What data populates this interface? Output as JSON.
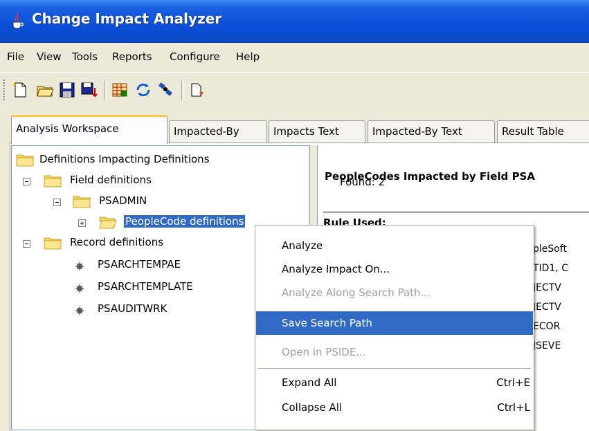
{
  "window": {
    "title": "Change Impact Analyzer",
    "icon": "java-cup-icon"
  },
  "menu": {
    "items": [
      "File",
      "View",
      "Tools",
      "Reports",
      "Configure",
      "Help"
    ]
  },
  "toolbar": {
    "buttons": [
      "new-document-icon",
      "open-folder-icon",
      "save-icon",
      "save-down-icon",
      "grid-icon",
      "refresh-icon",
      "satellite-icon",
      "export-icon"
    ]
  },
  "tabs": [
    "Analysis Workspace",
    "Impacted-By",
    "Impacts Text",
    "Impacted-By Text",
    "Result Table"
  ],
  "tree": {
    "root": "Definitions Impacting Definitions",
    "field_definitions": "Field definitions",
    "psadmin": "PSADMIN",
    "peoplecode_definitions": "PeopleCode definitions",
    "record_definitions": "Record definitions",
    "records": [
      "PSARCHTEMPAE",
      "PSARCHTEMPLATE",
      "PSAUDITWRK"
    ]
  },
  "result": {
    "title": "PeopleCodes Impacted by Field PSA",
    "found": "Found: 2",
    "rule_used": "Rule Used:",
    "lines": [
      "pleSoft",
      "TID1, C",
      "JECTV",
      "JECTV",
      "ECOR",
      "JSEVE"
    ]
  },
  "context_menu": {
    "items": [
      {
        "label": "Analyze",
        "shortcut": "",
        "disabled": false,
        "highlighted": false
      },
      {
        "label": "Analyze Impact On...",
        "shortcut": "",
        "disabled": false,
        "highlighted": false
      },
      {
        "label": "Analyze Along Search Path...",
        "shortcut": "",
        "disabled": true,
        "highlighted": false
      },
      {
        "label": "Save Search Path",
        "shortcut": "",
        "disabled": false,
        "highlighted": true
      },
      {
        "label": "Open in PSIDE...",
        "shortcut": "",
        "disabled": true,
        "highlighted": false
      },
      {
        "label": "Expand All",
        "shortcut": "Ctrl+E",
        "disabled": false,
        "highlighted": false
      },
      {
        "label": "Collapse All",
        "shortcut": "Ctrl+L",
        "disabled": false,
        "highlighted": false
      }
    ]
  },
  "colors": {
    "title_bar": "#0b4fd8",
    "selection": "#316ac5",
    "active_tab_accent": "#ffc83c"
  }
}
